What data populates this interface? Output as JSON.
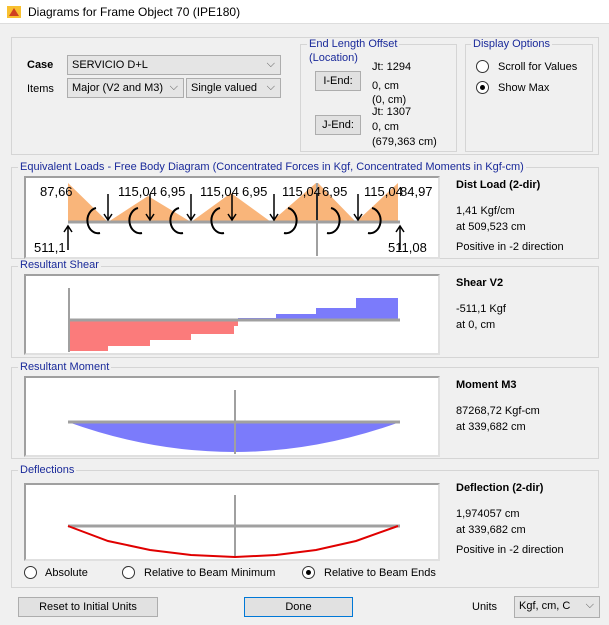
{
  "window": {
    "title": "Diagrams for Frame Object 70  (IPE180)"
  },
  "case": {
    "label": "Case",
    "value": "SERVICIO D+L"
  },
  "items": {
    "label": "Items",
    "value": "Major (V2 and M3)",
    "mode": "Single valued"
  },
  "end_offset": {
    "title1": "End Length Offset",
    "title2": "(Location)",
    "i_end": "I-End:",
    "j_end": "J-End:",
    "i_jt": "Jt:  1294",
    "i_val": "0, cm",
    "i_loc": "(0, cm)",
    "j_jt": "Jt:  1307",
    "j_val": "0, cm",
    "j_loc": "(679,363 cm)"
  },
  "display": {
    "title": "Display Options",
    "scroll": "Scroll for Values",
    "show_max": "Show Max",
    "selected": "Show Max"
  },
  "fbd": {
    "title": "Equivalent Loads - Free Body Diagram  (Concentrated Forces in Kgf, Concentrated Moments in Kgf-cm)",
    "left_top": "87,66",
    "labels": [
      "115,04",
      "6,95",
      "115,04",
      "6,95",
      "115,04",
      "6,95",
      "115,04"
    ],
    "right_top": "84,97",
    "left_reaction": "511,1",
    "right_reaction": "511,08",
    "info_title": "Dist Load (2-dir)",
    "info1": "1,41 Kgf/cm",
    "info2": "at 509,523 cm",
    "info3": "Positive in -2 direction"
  },
  "shear": {
    "title": "Resultant Shear",
    "info_title": "Shear V2",
    "info1": "-511,1 Kgf",
    "info2": "at 0, cm"
  },
  "moment": {
    "title": "Resultant Moment",
    "info_title": "Moment M3",
    "info1": "87268,72 Kgf-cm",
    "info2": "at 339,682 cm"
  },
  "deflection": {
    "title": "Deflections",
    "info_title": "Deflection (2-dir)",
    "info1": "1,974057 cm",
    "info2": "at 339,682 cm",
    "info3": "Positive in -2 direction"
  },
  "deflection_mode": {
    "options": [
      "Absolute",
      "Relative to Beam Minimum",
      "Relative to Beam Ends"
    ],
    "selected": "Relative to Beam Ends"
  },
  "footer": {
    "reset": "Reset to Initial Units",
    "done": "Done",
    "units_label": "Units",
    "units": "Kgf, cm, C"
  },
  "colors": {
    "load": "#f9b57a",
    "shear_neg": "#fb7b7b",
    "shear_pos": "#7b7bfb",
    "moment": "#7b7bfb",
    "deflection": "#e00000",
    "accent": "#1a2a9a"
  }
}
